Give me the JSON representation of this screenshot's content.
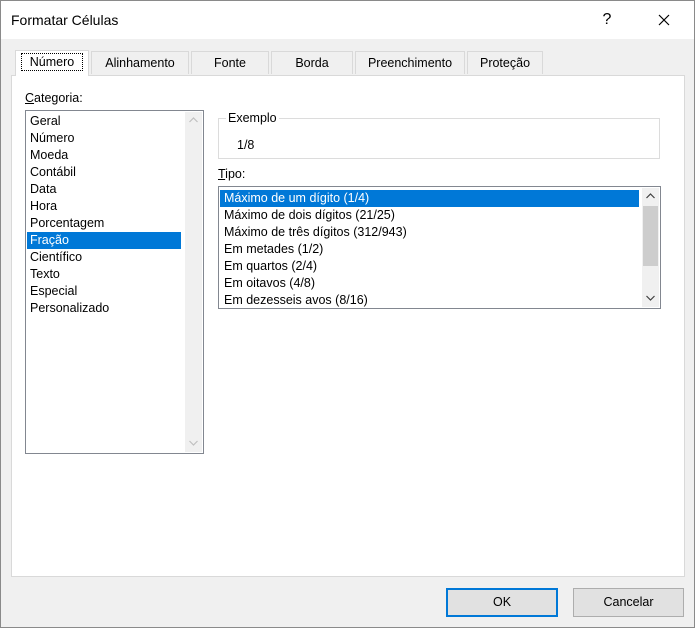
{
  "window": {
    "title": "Formatar Células",
    "help_glyph": "?"
  },
  "tabs": [
    {
      "label": "Número"
    },
    {
      "label": "Alinhamento"
    },
    {
      "label": "Fonte"
    },
    {
      "label": "Borda"
    },
    {
      "label": "Preenchimento"
    },
    {
      "label": "Proteção"
    }
  ],
  "categoria": {
    "label_hotkey": "C",
    "label_rest": "ategoria:",
    "items": [
      "Geral",
      "Número",
      "Moeda",
      "Contábil",
      "Data",
      "Hora",
      "Porcentagem",
      "Fração",
      "Científico",
      "Texto",
      "Especial",
      "Personalizado"
    ],
    "selected": "Fração"
  },
  "exemplo": {
    "label": "Exemplo",
    "value": "1/8"
  },
  "tipo": {
    "label_hotkey": "T",
    "label_rest": "ipo:",
    "items": [
      "Máximo de um dígito (1/4)",
      "Máximo de dois dígitos (21/25)",
      "Máximo de três dígitos (312/943)",
      "Em metades (1/2)",
      "Em quartos (2/4)",
      "Em oitavos (4/8)",
      "Em dezesseis avos (8/16)"
    ],
    "selected": "Máximo de um dígito (1/4)"
  },
  "buttons": {
    "ok": "OK",
    "cancel": "Cancelar"
  },
  "colors": {
    "accent": "#0078d7",
    "panel": "#ffffff",
    "chrome": "#f0f0f0"
  }
}
